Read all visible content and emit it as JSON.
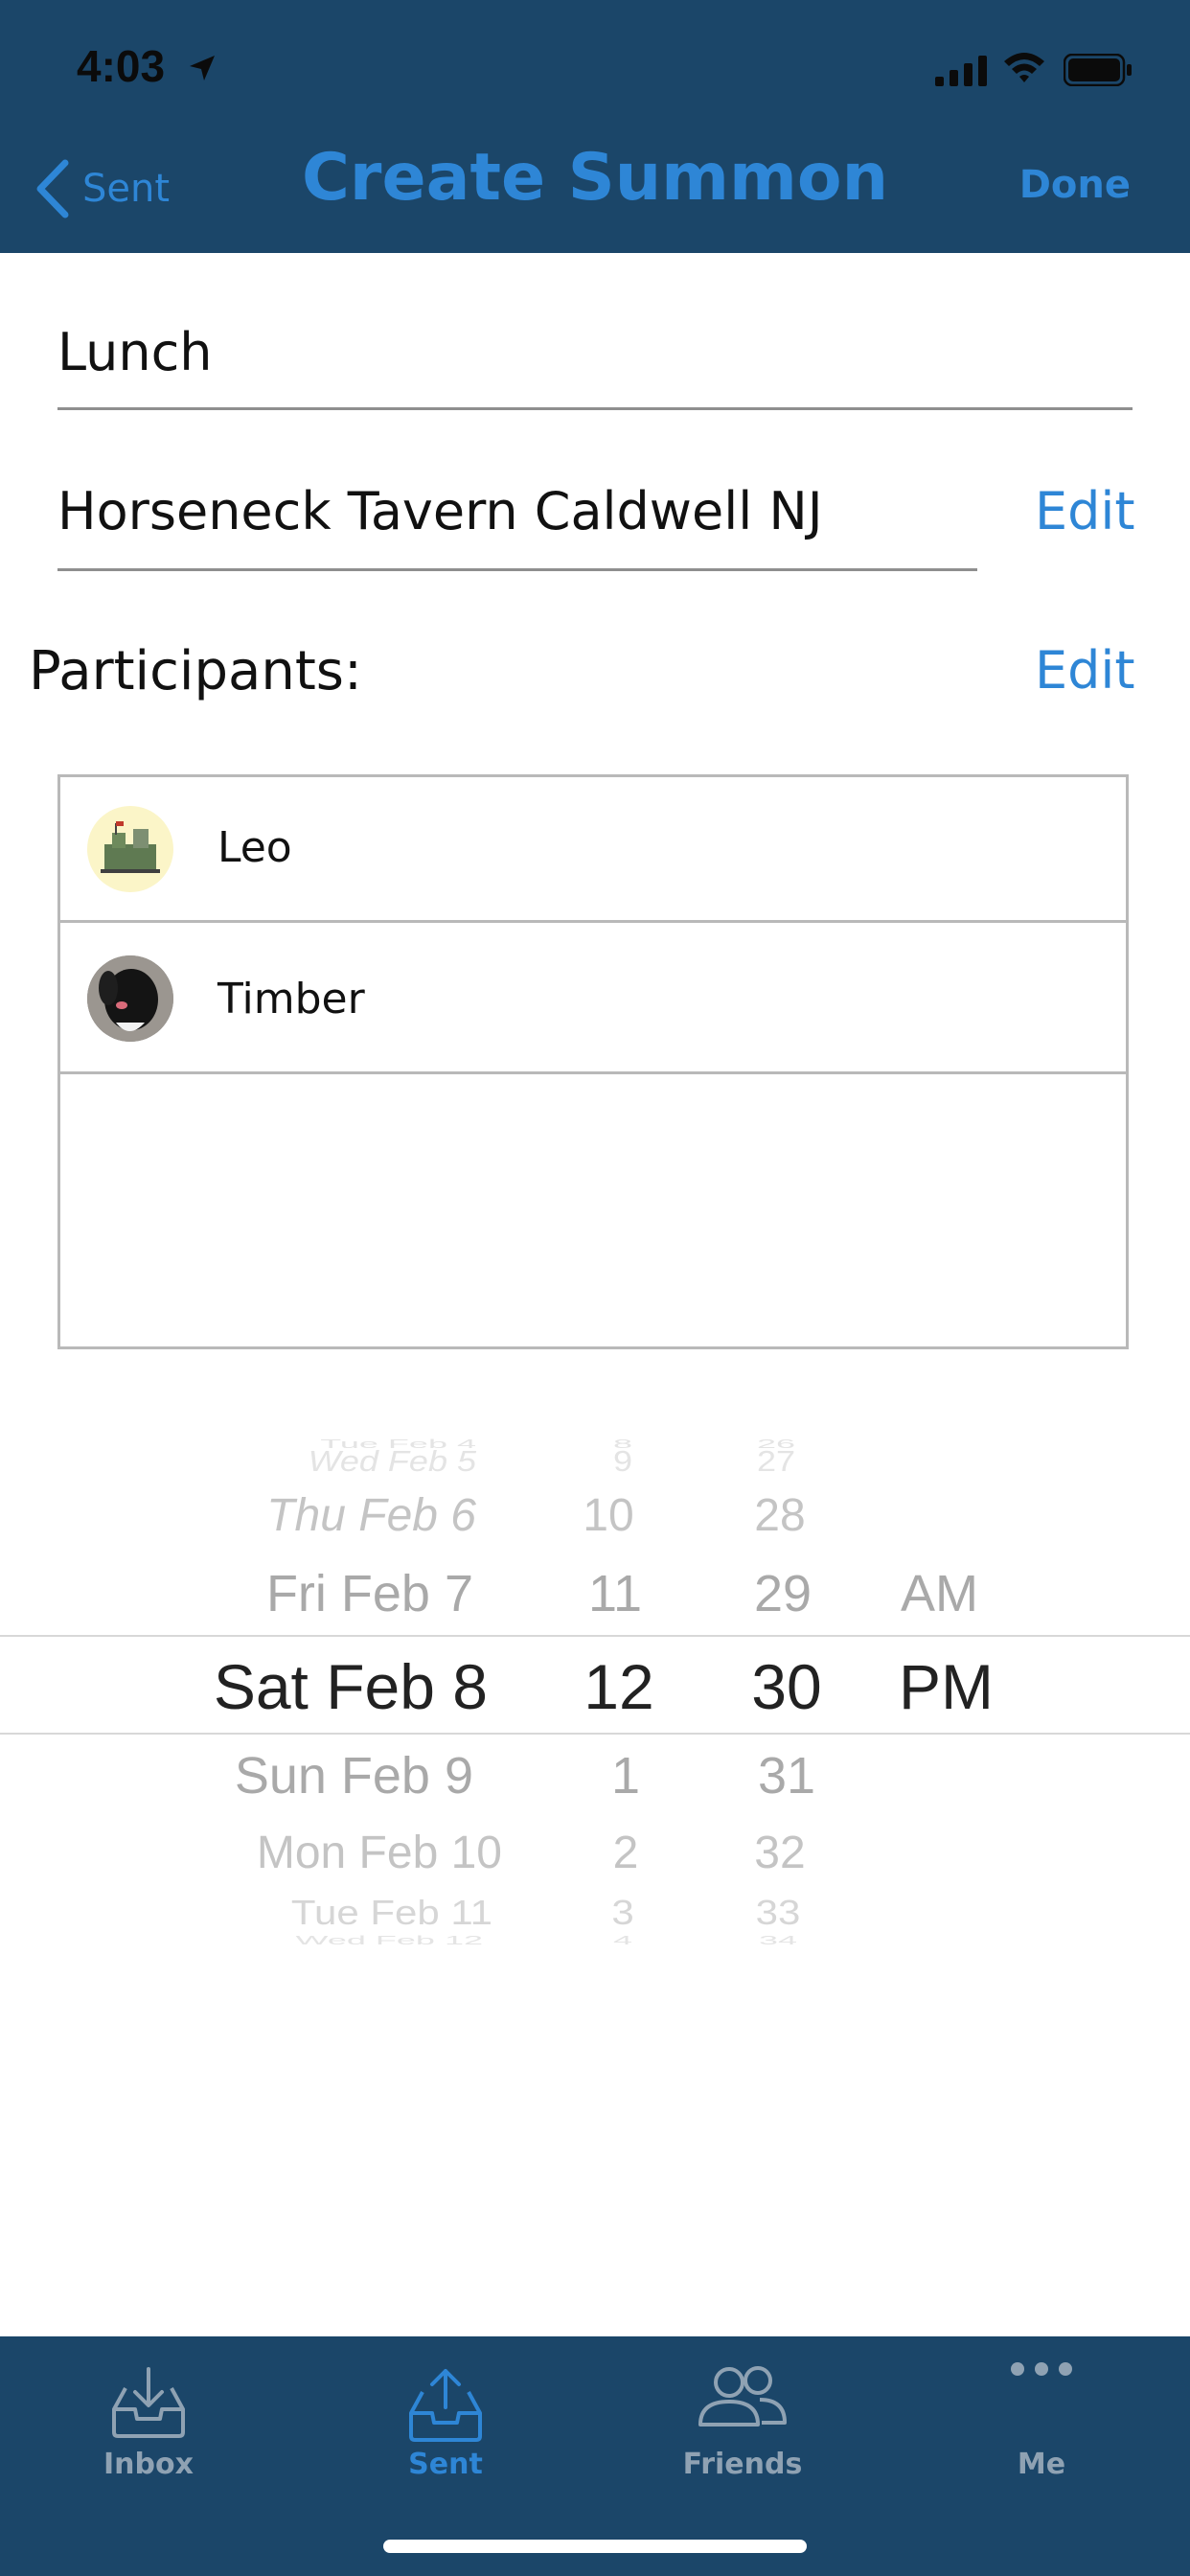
{
  "status_bar": {
    "time": "4:03"
  },
  "nav": {
    "back_label": "Sent",
    "title": "Create Summon",
    "done_label": "Done"
  },
  "form": {
    "title_value": "Lunch",
    "location_value": "Horseneck Tavern Caldwell NJ",
    "location_edit": "Edit",
    "participants_label": "Participants:",
    "participants_edit": "Edit"
  },
  "participants": [
    {
      "name": "Leo"
    },
    {
      "name": "Timber"
    }
  ],
  "picker": {
    "dates": [
      "Tue Feb 4",
      "Wed Feb 5",
      "Thu Feb 6",
      "Fri Feb 7",
      "Sat Feb 8",
      "Sun Feb 9",
      "Mon Feb 10",
      "Tue Feb 11",
      "Wed Feb 12"
    ],
    "hours": [
      "8",
      "9",
      "10",
      "11",
      "12",
      "1",
      "2",
      "3",
      "4"
    ],
    "minutes": [
      "26",
      "27",
      "28",
      "29",
      "30",
      "31",
      "32",
      "33",
      "34"
    ],
    "ampm": [
      "AM",
      "PM"
    ]
  },
  "tabs": [
    {
      "label": "Inbox"
    },
    {
      "label": "Sent"
    },
    {
      "label": "Friends"
    },
    {
      "label": "Me"
    }
  ],
  "colors": {
    "header_bg": "#1b4669",
    "accent": "#2e86d6",
    "tab_inactive": "#8fa2b3"
  }
}
